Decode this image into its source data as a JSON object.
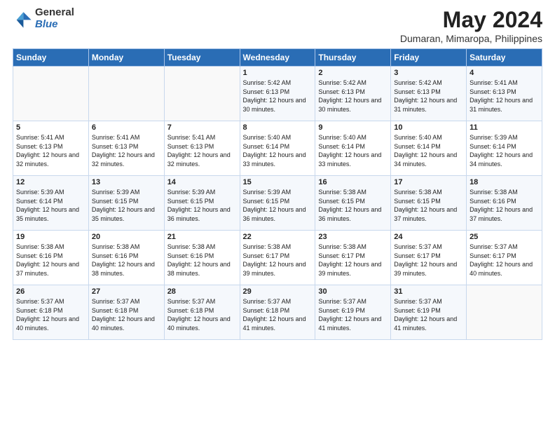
{
  "header": {
    "logo_general": "General",
    "logo_blue": "Blue",
    "month_year": "May 2024",
    "location": "Dumaran, Mimaropa, Philippines"
  },
  "weekdays": [
    "Sunday",
    "Monday",
    "Tuesday",
    "Wednesday",
    "Thursday",
    "Friday",
    "Saturday"
  ],
  "weeks": [
    [
      {
        "day": "",
        "info": ""
      },
      {
        "day": "",
        "info": ""
      },
      {
        "day": "",
        "info": ""
      },
      {
        "day": "1",
        "info": "Sunrise: 5:42 AM\nSunset: 6:13 PM\nDaylight: 12 hours and 30 minutes."
      },
      {
        "day": "2",
        "info": "Sunrise: 5:42 AM\nSunset: 6:13 PM\nDaylight: 12 hours and 30 minutes."
      },
      {
        "day": "3",
        "info": "Sunrise: 5:42 AM\nSunset: 6:13 PM\nDaylight: 12 hours and 31 minutes."
      },
      {
        "day": "4",
        "info": "Sunrise: 5:41 AM\nSunset: 6:13 PM\nDaylight: 12 hours and 31 minutes."
      }
    ],
    [
      {
        "day": "5",
        "info": "Sunrise: 5:41 AM\nSunset: 6:13 PM\nDaylight: 12 hours and 32 minutes."
      },
      {
        "day": "6",
        "info": "Sunrise: 5:41 AM\nSunset: 6:13 PM\nDaylight: 12 hours and 32 minutes."
      },
      {
        "day": "7",
        "info": "Sunrise: 5:41 AM\nSunset: 6:13 PM\nDaylight: 12 hours and 32 minutes."
      },
      {
        "day": "8",
        "info": "Sunrise: 5:40 AM\nSunset: 6:14 PM\nDaylight: 12 hours and 33 minutes."
      },
      {
        "day": "9",
        "info": "Sunrise: 5:40 AM\nSunset: 6:14 PM\nDaylight: 12 hours and 33 minutes."
      },
      {
        "day": "10",
        "info": "Sunrise: 5:40 AM\nSunset: 6:14 PM\nDaylight: 12 hours and 34 minutes."
      },
      {
        "day": "11",
        "info": "Sunrise: 5:39 AM\nSunset: 6:14 PM\nDaylight: 12 hours and 34 minutes."
      }
    ],
    [
      {
        "day": "12",
        "info": "Sunrise: 5:39 AM\nSunset: 6:14 PM\nDaylight: 12 hours and 35 minutes."
      },
      {
        "day": "13",
        "info": "Sunrise: 5:39 AM\nSunset: 6:15 PM\nDaylight: 12 hours and 35 minutes."
      },
      {
        "day": "14",
        "info": "Sunrise: 5:39 AM\nSunset: 6:15 PM\nDaylight: 12 hours and 36 minutes."
      },
      {
        "day": "15",
        "info": "Sunrise: 5:39 AM\nSunset: 6:15 PM\nDaylight: 12 hours and 36 minutes."
      },
      {
        "day": "16",
        "info": "Sunrise: 5:38 AM\nSunset: 6:15 PM\nDaylight: 12 hours and 36 minutes."
      },
      {
        "day": "17",
        "info": "Sunrise: 5:38 AM\nSunset: 6:15 PM\nDaylight: 12 hours and 37 minutes."
      },
      {
        "day": "18",
        "info": "Sunrise: 5:38 AM\nSunset: 6:16 PM\nDaylight: 12 hours and 37 minutes."
      }
    ],
    [
      {
        "day": "19",
        "info": "Sunrise: 5:38 AM\nSunset: 6:16 PM\nDaylight: 12 hours and 37 minutes."
      },
      {
        "day": "20",
        "info": "Sunrise: 5:38 AM\nSunset: 6:16 PM\nDaylight: 12 hours and 38 minutes."
      },
      {
        "day": "21",
        "info": "Sunrise: 5:38 AM\nSunset: 6:16 PM\nDaylight: 12 hours and 38 minutes."
      },
      {
        "day": "22",
        "info": "Sunrise: 5:38 AM\nSunset: 6:17 PM\nDaylight: 12 hours and 39 minutes."
      },
      {
        "day": "23",
        "info": "Sunrise: 5:38 AM\nSunset: 6:17 PM\nDaylight: 12 hours and 39 minutes."
      },
      {
        "day": "24",
        "info": "Sunrise: 5:37 AM\nSunset: 6:17 PM\nDaylight: 12 hours and 39 minutes."
      },
      {
        "day": "25",
        "info": "Sunrise: 5:37 AM\nSunset: 6:17 PM\nDaylight: 12 hours and 40 minutes."
      }
    ],
    [
      {
        "day": "26",
        "info": "Sunrise: 5:37 AM\nSunset: 6:18 PM\nDaylight: 12 hours and 40 minutes."
      },
      {
        "day": "27",
        "info": "Sunrise: 5:37 AM\nSunset: 6:18 PM\nDaylight: 12 hours and 40 minutes."
      },
      {
        "day": "28",
        "info": "Sunrise: 5:37 AM\nSunset: 6:18 PM\nDaylight: 12 hours and 40 minutes."
      },
      {
        "day": "29",
        "info": "Sunrise: 5:37 AM\nSunset: 6:18 PM\nDaylight: 12 hours and 41 minutes."
      },
      {
        "day": "30",
        "info": "Sunrise: 5:37 AM\nSunset: 6:19 PM\nDaylight: 12 hours and 41 minutes."
      },
      {
        "day": "31",
        "info": "Sunrise: 5:37 AM\nSunset: 6:19 PM\nDaylight: 12 hours and 41 minutes."
      },
      {
        "day": "",
        "info": ""
      }
    ]
  ]
}
